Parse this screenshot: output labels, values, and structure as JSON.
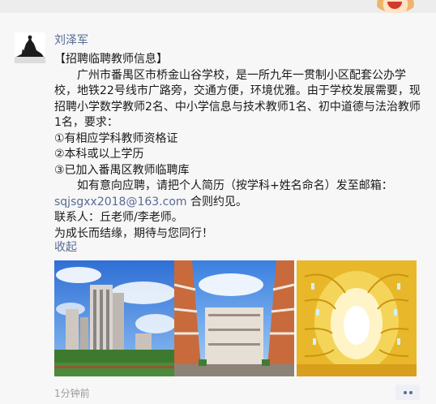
{
  "post": {
    "author": "刘泽军",
    "title": "【招聘临聘教师信息】",
    "para1": "广州市番禺区市桥金山谷学校，是一所九年一贯制小区配套公办学校，地铁22号线市广路旁，交通方便，环境优雅。由于学校发展需要，现招聘小学数学教师2名、中小学信息与技术教师1名、初中道德与法治教师1名，要求：",
    "req1": "①有相应学科教师资格证",
    "req2": "②本科或以上学历",
    "req3": "③已加入番禺区教师临聘库",
    "para2": "如有意向应聘，请把个人简历（按学科+姓名命名）发至邮箱：",
    "email": "sqjsgxx2018@163.com",
    "email_suffix": " 合则约见。",
    "contact": "联系人：丘老师/李老师。",
    "closing": "为成长而结缘，期待与您同行！",
    "collapse_label": "收起",
    "time": "1分钟前"
  },
  "photos": [
    {
      "name": "photo-school-building"
    },
    {
      "name": "photo-school-courtyard"
    },
    {
      "name": "photo-library"
    }
  ],
  "colors": {
    "link": "#576b95",
    "text": "#1a1a1a",
    "meta": "#9b9b9b",
    "background": "#f7f7f7"
  },
  "icons": {
    "avatar": "silhouette-avatar-icon",
    "more": "more-dots-icon"
  }
}
